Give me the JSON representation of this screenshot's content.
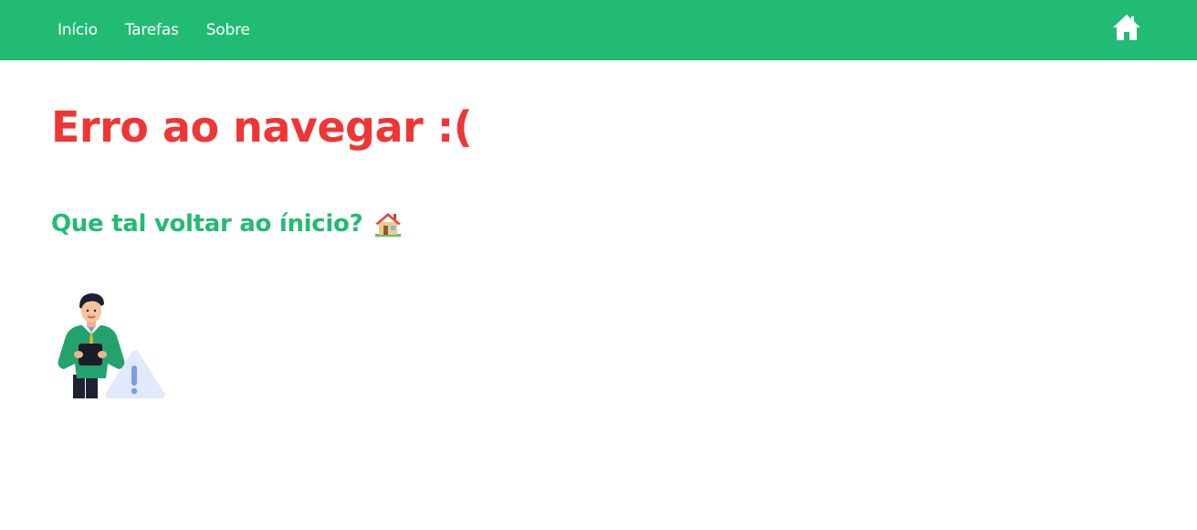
{
  "nav": {
    "links": [
      {
        "label": "Início"
      },
      {
        "label": "Tarefas"
      },
      {
        "label": "Sobre"
      }
    ],
    "home_icon": "home-icon"
  },
  "main": {
    "title": "Erro ao navegar :(",
    "back_text": "Que tal voltar ao ínicio?",
    "back_icon": "house-emoji-icon",
    "illustration": "person-with-warning-illustration"
  },
  "colors": {
    "brand_green": "#22bb73",
    "error_red": "#f03535"
  }
}
